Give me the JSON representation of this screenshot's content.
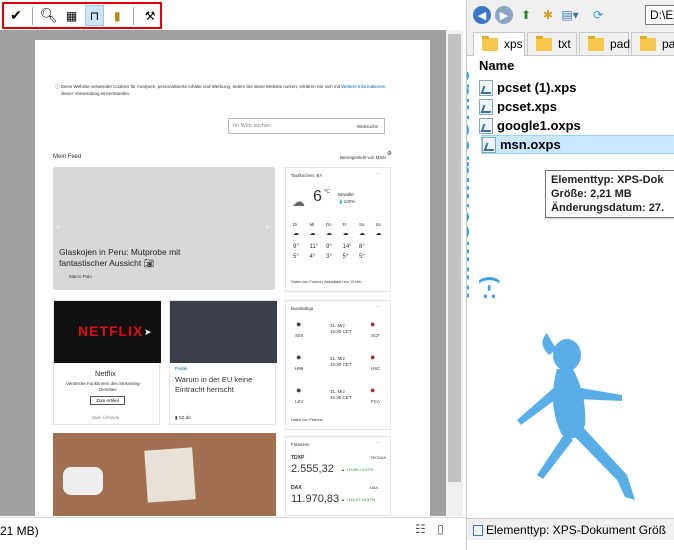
{
  "viewer": {
    "toolbar": {
      "icons": [
        "checkmark-icon",
        "zoom-icon",
        "filmstrip-icon",
        "presentation-icon",
        "book-icon",
        "tools-icon"
      ]
    },
    "status_text": "21 MB)",
    "view_icons": "☷ ▯"
  },
  "document": {
    "cookie_notice": "Diese Website verwendet Cookies für Analysen, personalisierte Inhalte und Werbung. Indem Sie diese Website nutzen, erklären Sie sich mit",
    "cookie_link": "Weitere Informationen",
    "cookie_notice_2": "dieser Verwendung einverstanden.",
    "search_placeholder": "Im Web suchen",
    "search_label": "Websuche",
    "feed_title": "Mein Feed",
    "feed_sponsor": "Bereitgestellt von MSN",
    "hero_headline_1": "Glaskojen in Peru: Mutprobe mit",
    "hero_headline_2": "fantastischer Aussicht",
    "hero_source": "Marco Polo",
    "weather": {
      "location": "Taufkirchen, BY",
      "temp": "6",
      "unit": "°C",
      "condition": "Bewölkt",
      "humidity": "100%",
      "days": [
        "Di",
        "Mi",
        "Do",
        "Fr",
        "Sa",
        "So"
      ],
      "highs": [
        "9°",
        "11°",
        "9°",
        "14°",
        "8°"
      ],
      "lows": [
        "5°",
        "4°",
        "3°",
        "5°",
        "5°"
      ],
      "source": "Daten von Foreca | Aktualisiert vor 10 Min."
    },
    "bundesliga": {
      "title": "Bundesliga",
      "matches": [
        {
          "home": "S04",
          "date": "31. Mrz",
          "time": "15:30 CET",
          "away": "SCF"
        },
        {
          "home": "H96",
          "date": "31. Mrz",
          "time": "15:30 CET",
          "away": "HSC"
        },
        {
          "home": "LEV",
          "date": "31. Mrz",
          "time": "15:30 CET",
          "away": "FCA"
        }
      ],
      "footer": "Daten von Perform"
    },
    "netflix": {
      "brand": "NETFLIX",
      "title": "Netflix",
      "desc_1": "Verstecke Funktionen des Streaming-",
      "desc_2": "Dienstes",
      "button": "Zum Artikel",
      "source": "Multi Lifestyle"
    },
    "politics": {
      "category": "Politik",
      "title_1": "Warum in der EU keine",
      "title_2": "Eintracht herrscht",
      "source": "SZ.de"
    },
    "finance": {
      "title": "Finanzen",
      "rows": [
        {
          "name": "TDXP",
          "exchange": "TECDAX",
          "value": "2.555,32",
          "change": "+14,95 +0,57%"
        },
        {
          "name": "DAX",
          "exchange": "DAX",
          "value": "11.970,83",
          "change": "+115,97 +0,97%"
        }
      ]
    }
  },
  "explorer": {
    "address": "D:\\E",
    "tabs": [
      "xps",
      "txt",
      "pad",
      "pad"
    ],
    "column_header": "Name",
    "files": [
      "pcset (1).xps",
      "pcset.xps",
      "google1.oxps",
      "msn.oxps"
    ],
    "tooltip": {
      "line1": "Elementtyp: XPS-Dok",
      "line2": "Größe: 2,21 MB",
      "line3": "Änderungsdatum: 27."
    },
    "watermark": "www.SoftwareOK.de :-)",
    "status": "Elementtyp: XPS-Dokument Größ"
  },
  "colors": {
    "toolbar_highlight": "#e00000",
    "selection": "#cce8ff",
    "watermark": "#3aa0e8",
    "positive": "#1a8a1a"
  }
}
